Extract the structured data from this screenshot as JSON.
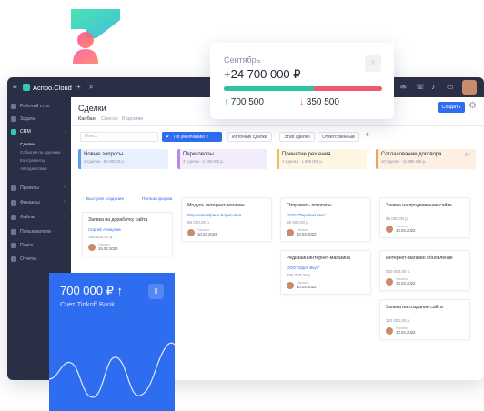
{
  "app": {
    "brand": "Аспро.Cloud",
    "search_icon": "search-icon",
    "topbar_icons": [
      "mail-icon",
      "phone-icon",
      "bell-icon",
      "chat-icon",
      "user-avatar"
    ]
  },
  "sidebar": {
    "items": [
      {
        "label": "Рабочий стол",
        "icon": "desktop-icon"
      },
      {
        "label": "Задачи",
        "icon": "tasks-icon"
      },
      {
        "label": "CRM",
        "icon": "crm-icon",
        "active": true
      },
      {
        "label": "Проекты",
        "icon": "projects-icon"
      },
      {
        "label": "Финансы",
        "icon": "finance-icon"
      },
      {
        "label": "Файлы",
        "icon": "files-icon"
      },
      {
        "label": "Пользователи",
        "icon": "users-icon"
      },
      {
        "label": "Поиск",
        "icon": "search-icon"
      },
      {
        "label": "Отчеты",
        "icon": "reports-icon"
      }
    ],
    "crm_sub": [
      "Сделки",
      "События по сделкам",
      "Контрагенты",
      "Автодействия"
    ]
  },
  "page": {
    "title": "Сделки",
    "tabs": [
      "Канбан",
      "Список",
      "В архиве"
    ],
    "create_label": "Создать",
    "search_placeholder": "Поиск",
    "filter_label": "По умолчанию ×",
    "chips": [
      "Источник сделки",
      "Этап сделки",
      "Ответственный"
    ]
  },
  "columns": [
    {
      "name": "Новые запросы",
      "sub": "1 Сделка · 95 000,00 р.",
      "color": "#5b9bf0",
      "bg": "#e8f0fd"
    },
    {
      "name": "Переговоры",
      "sub": "4 Сделки · 2 330 000 р.",
      "color": "#b58be6",
      "bg": "#f3ecfc"
    },
    {
      "name": "Принятие решения",
      "sub": "1 Сделка · 1 000 000 р.",
      "color": "#e8c25a",
      "bg": "#fdf6e3"
    },
    {
      "name": "Согласование договора",
      "sub": "10 Сделок · 11 880 490 р.",
      "color": "#f0a05a",
      "bg": "#fdefe2",
      "extra": "2 +"
    }
  ],
  "quick_create": "Быстрое создание",
  "full_form": "Полная форма",
  "cards": [
    {
      "col": 0,
      "title": "Заявка на доработку сайта",
      "link": "Сергей Арнаутов",
      "price": "195 000,00 р.",
      "who": "Начало",
      "date": "15.02.2022"
    },
    {
      "col": 1,
      "title": "Модуль интернет-магазин",
      "link": "Морохова Ирина Борисовна",
      "price": "95 000,00 р.",
      "who": "Начало",
      "date": "10.03.2022"
    },
    {
      "col": 2,
      "title": "Отправить логотипы",
      "link": "ООО \"Перспективы\"",
      "price": "95 000,00 р.",
      "who": "Начало",
      "date": "10.03.2022"
    },
    {
      "col": 3,
      "title": "Заявка на продвижение сайта",
      "link": "",
      "price": "95 000,00 р.",
      "who": "Начало",
      "date": "10.03.2022"
    },
    {
      "col": 2,
      "title": "Редизайн интернет-магазина",
      "link": "ООО \"Идея Вкус\"",
      "price": "795 000,00 р.",
      "who": "Начало",
      "date": "10.03.2022"
    },
    {
      "col": 3,
      "title": "Интернет-магазин обновление",
      "link": "",
      "price": "530 000,00 р.",
      "who": "Начало",
      "date": "10.03.2022"
    },
    {
      "col": 3,
      "title": "Заявка на создание сайта",
      "link": "",
      "price": "110 000,00 р.",
      "who": "Начало",
      "date": "10.03.2022"
    }
  ],
  "september": {
    "month": "Сентябрь",
    "total": "+24 700 000 ₽",
    "income": "700 500",
    "expense": "350 500",
    "income_share": 0.57,
    "income_color": "#2ec4a0",
    "expense_color": "#ef5a6f",
    "icon": "expand-icon"
  },
  "bank": {
    "amount": "700 000 ₽ ↑",
    "label": "Счет Tinkoff Bank",
    "icon": "expand-icon",
    "color": "#2f6df0"
  }
}
